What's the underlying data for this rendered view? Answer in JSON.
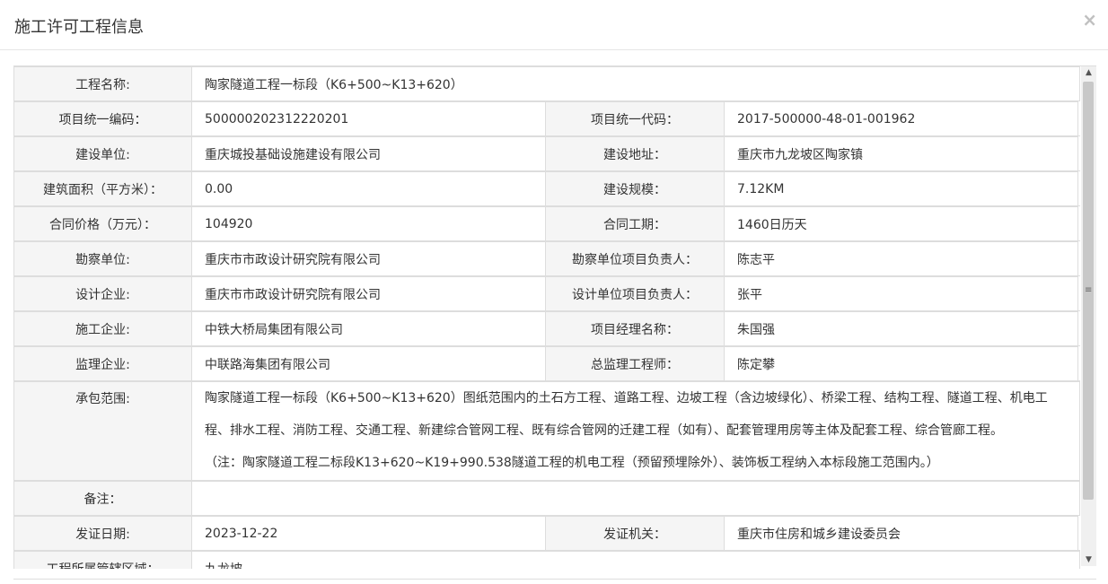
{
  "modal": {
    "title": "施工许可工程信息",
    "close": "×"
  },
  "rows": {
    "project_name": {
      "label": "工程名称:",
      "value": "陶家隧道工程一标段（K6+500~K13+620）"
    },
    "row2": {
      "l1": "项目统一编码：",
      "v1": "500000202312220201",
      "l2": "项目统一代码：",
      "v2": "2017-500000-48-01-001962"
    },
    "row3": {
      "l1": "建设单位:",
      "v1": "重庆城投基础设施建设有限公司",
      "l2": "建设地址：",
      "v2": "重庆市九龙坡区陶家镇"
    },
    "row4": {
      "l1": "建筑面积（平方米）：",
      "v1": "0.00",
      "l2": "建设规模：",
      "v2": "7.12KM"
    },
    "row5": {
      "l1": "合同价格（万元）：",
      "v1": "104920",
      "l2": "合同工期：",
      "v2": "1460日历天"
    },
    "row6": {
      "l1": "勘察单位:",
      "v1": "重庆市市政设计研究院有限公司",
      "l2": "勘察单位项目负责人：",
      "v2": "陈志平"
    },
    "row7": {
      "l1": "设计企业:",
      "v1": "重庆市市政设计研究院有限公司",
      "l2": "设计单位项目负责人：",
      "v2": "张平"
    },
    "row8": {
      "l1": "施工企业:",
      "v1": "中铁大桥局集团有限公司",
      "l2": "项目经理名称：",
      "v2": "朱国强"
    },
    "row9": {
      "l1": "监理企业:",
      "v1": "中联路海集团有限公司",
      "l2": "总监理工程师：",
      "v2": "陈定攀"
    },
    "scope": {
      "label": "承包范围:",
      "line1": "陶家隧道工程一标段（K6+500~K13+620）图纸范围内的土石方工程、道路工程、边坡工程（含边坡绿化）、桥梁工程、结构工程、隧道工程、机电工",
      "line2": "程、排水工程、消防工程、交通工程、新建综合管网工程、既有综合管网的迁建工程（如有）、配套管理用房等主体及配套工程、综合管廊工程。",
      "line3": "（注：陶家隧道工程二标段K13+620~K19+990.538隧道工程的机电工程（预留预埋除外）、装饰板工程纳入本标段施工范围内。）"
    },
    "remark": {
      "label": "备注：",
      "value": ""
    },
    "row12": {
      "l1": "发证日期:",
      "v1": "2023-12-22",
      "l2": "发证机关：",
      "v2": "重庆市住房和城乡建设委员会"
    },
    "row13": {
      "l1": "工程所属管辖区域：",
      "v1": "九龙坡"
    }
  },
  "scrollbar": {
    "up": "▲",
    "down": "▼",
    "grip": "≡"
  }
}
